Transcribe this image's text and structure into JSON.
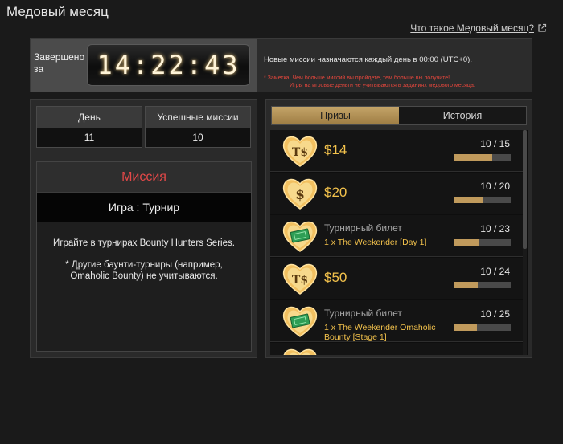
{
  "header": {
    "title": "Медовый месяц",
    "help_link": "Что такое Медовый месяц?"
  },
  "banner": {
    "ends_label": "Завершено за",
    "timer": "14:22:43",
    "info": "Новые миссии назначаются каждый день в 00:00 (UTC+0).",
    "note_line1": "* Заметка: Чем больше миссий вы пройдете, тем больше вы получите!",
    "note_line2": "Игры на игровые деньги не учитываются в заданиях медового месяца."
  },
  "stats": {
    "day_label": "День",
    "day_value": "11",
    "success_label": "Успешные миссии",
    "success_value": "10"
  },
  "mission": {
    "title": "Миссия",
    "game": "Игра : Турнир",
    "body1": "Играйте в турнирах Bounty Hunters Series.",
    "body2": "* Другие баунти-турниры (например, Omaholic Bounty) не учитываются."
  },
  "tabs": {
    "prizes": "Призы",
    "history": "История"
  },
  "prizes": [
    {
      "kind": "cash",
      "icon": "ts-heart-icon",
      "amount": "$14",
      "progress": "10 / 15",
      "fraction": 0.667
    },
    {
      "kind": "cash",
      "icon": "dollar-heart-icon",
      "amount": "$20",
      "progress": "10 / 20",
      "fraction": 0.5
    },
    {
      "kind": "ticket",
      "icon": "ticket-heart-icon",
      "type": "Турнирный билет",
      "desc": "1 x The Weekender [Day 1]",
      "progress": "10 / 23",
      "fraction": 0.435
    },
    {
      "kind": "cash",
      "icon": "ts-heart-icon",
      "amount": "$50",
      "progress": "10 / 24",
      "fraction": 0.417
    },
    {
      "kind": "ticket",
      "icon": "ticket-heart-icon",
      "type": "Турнирный билет",
      "desc": "1 x The Weekender Omaholic Bounty [Stage 1]",
      "progress": "10 / 25",
      "fraction": 0.4
    }
  ],
  "colors": {
    "accent_gold": "#f3c24c",
    "mission_red": "#e34848",
    "progress_fill": "#c09a5c"
  }
}
